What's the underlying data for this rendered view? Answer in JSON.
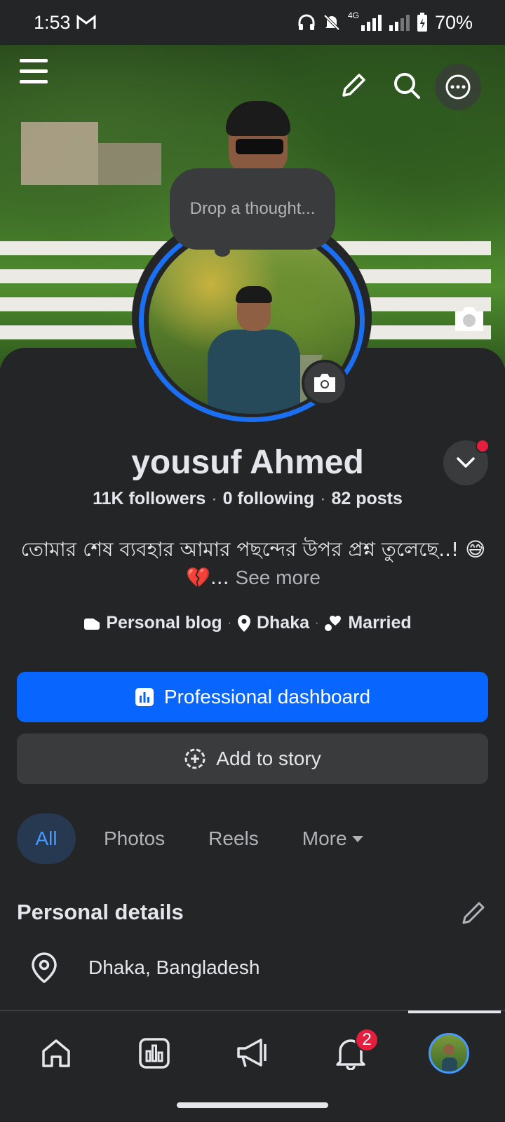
{
  "status_bar": {
    "time": "1:53",
    "battery": "70%",
    "network": "4G"
  },
  "profile": {
    "thought_placeholder": "Drop a thought...",
    "name": "yousuf Ahmed",
    "followers": "11K followers",
    "following": "0 following",
    "posts": "82 posts",
    "bio": "তোমার শেষ ব্যবহার আমার পছন্দের উপর প্রশ্ন তুলেছে..! 😅💔...",
    "see_more": "See more",
    "details": {
      "category": "Personal blog",
      "location": "Dhaka",
      "relationship": "Married"
    }
  },
  "actions": {
    "professional_dashboard": "Professional dashboard",
    "add_to_story": "Add to story"
  },
  "tabs": [
    {
      "label": "All"
    },
    {
      "label": "Photos"
    },
    {
      "label": "Reels"
    },
    {
      "label": "More"
    }
  ],
  "personal_details": {
    "title": "Personal details",
    "location": "Dhaka, Bangladesh"
  },
  "bottom_nav": {
    "notifications_count": "2"
  },
  "colors": {
    "background": "#242526",
    "accent_blue": "#0866ff",
    "badge_red": "#e41e3f",
    "active_tab_bg": "#263951"
  }
}
